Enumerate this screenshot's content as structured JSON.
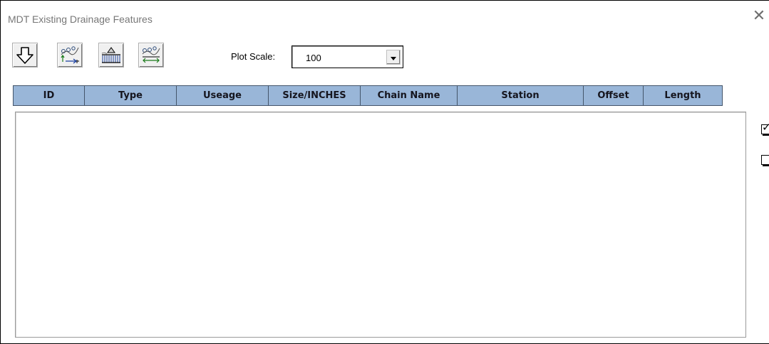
{
  "window": {
    "title": "MDT Existing Drainage Features",
    "close_glyph": "✕"
  },
  "toolbar": {
    "buttons": [
      {
        "icon": "down-arrow-icon"
      },
      {
        "icon": "profile-elevation-icon"
      },
      {
        "icon": "culvert-section-icon"
      },
      {
        "icon": "profile-offset-icon"
      }
    ],
    "plot_scale_label": "Plot Scale:",
    "plot_scale_value": "100"
  },
  "table": {
    "columns": [
      "ID",
      "Type",
      "Useage",
      "Size/INCHES",
      "Chain Name",
      "Station",
      "Offset",
      "Length"
    ],
    "rows": []
  },
  "checkboxes": [
    {
      "checked": true
    },
    {
      "checked": false
    }
  ]
}
